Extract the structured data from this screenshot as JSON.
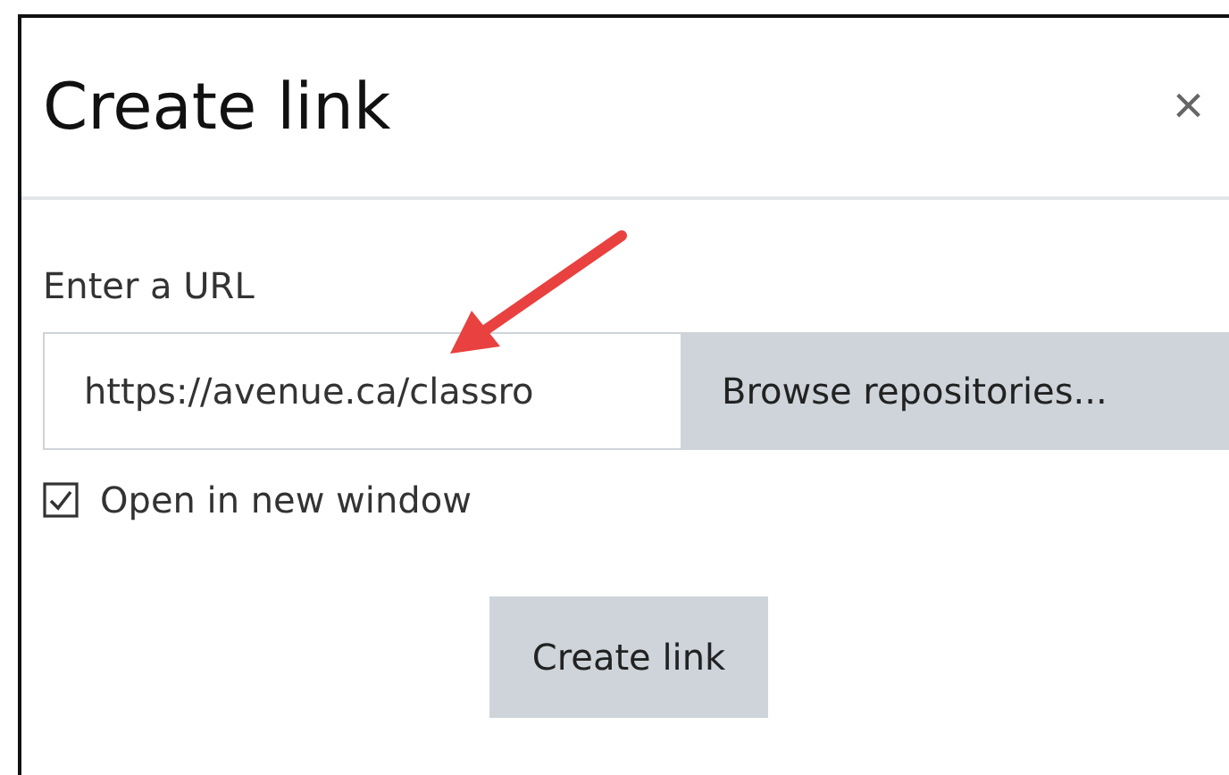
{
  "dialog": {
    "title": "Create link",
    "close": "×"
  },
  "url_label": "Enter a URL",
  "url_field": {
    "value": "https://avenue.ca/classro"
  },
  "browse_button": "Browse repositories...",
  "open_in_new_window": {
    "label": "Open in new window",
    "checked": true
  },
  "submit_button": "Create link",
  "annotation": {
    "kind": "arrow"
  }
}
